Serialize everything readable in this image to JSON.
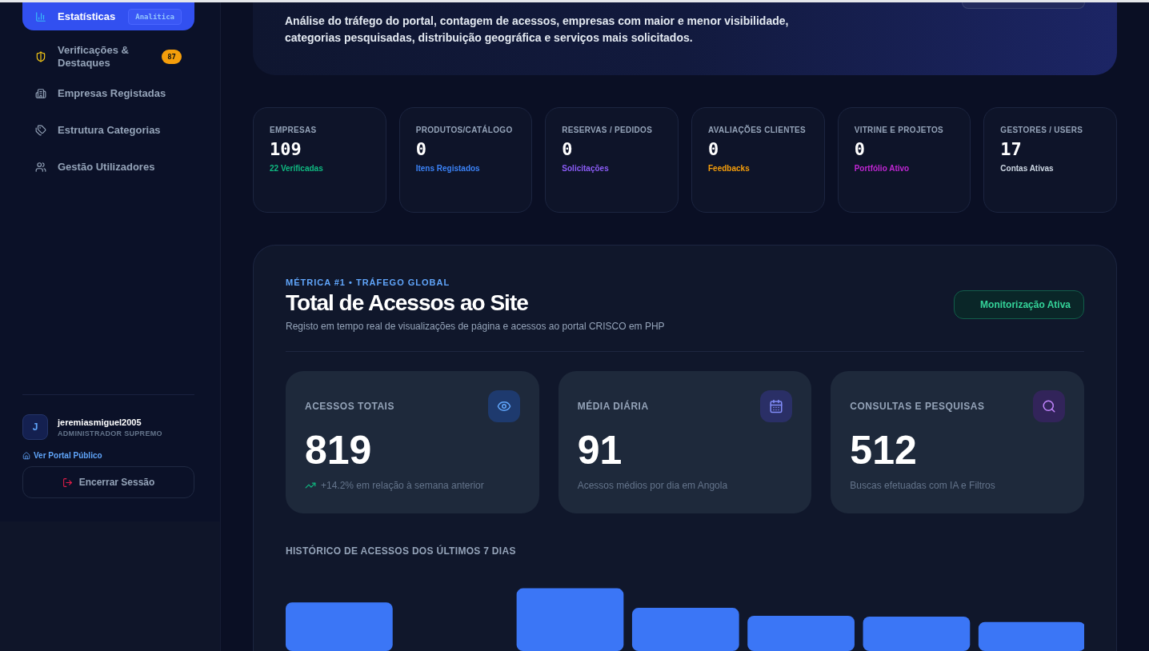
{
  "sidebar": {
    "items": [
      {
        "label": "Estatísticas",
        "selected": true,
        "tag": "Analítica"
      },
      {
        "label": "Verificações & Destaques",
        "selected": false,
        "badge": "87"
      },
      {
        "label": "Empresas Registadas",
        "selected": false
      },
      {
        "label": "Estrutura Categorias",
        "selected": false
      },
      {
        "label": "Gestão Utilizadores",
        "selected": false
      }
    ],
    "user": {
      "initial": "J",
      "name": "jeremiasmiguel2005",
      "role": "ADMINISTRADOR SUPREMO"
    },
    "portal_link": "Ver Portal Público",
    "logout": "Encerrar Sessão"
  },
  "hero": {
    "description": "Análise do tráfego do portal, contagem de acessos, empresas com maior e menor visibilidade, categorias pesquisadas, distribuição geográfica e serviços mais solicitados."
  },
  "stats": [
    {
      "label": "EMPRESAS",
      "value": "109",
      "note": "22 Verificadas",
      "color": "#10b981"
    },
    {
      "label": "PRODUTOS/CATÁLOGO",
      "value": "0",
      "note": "Itens Registados",
      "color": "#3b82f6"
    },
    {
      "label": "RESERVAS / PEDIDOS",
      "value": "0",
      "note": "Solicitações",
      "color": "#8b5cf6"
    },
    {
      "label": "AVALIAÇÕES CLIENTES",
      "value": "0",
      "note": "Feedbacks",
      "color": "#f59e0b"
    },
    {
      "label": "VITRINE E PROJETOS",
      "value": "0",
      "note": "Portfólio Ativo",
      "color": "#c026d3"
    },
    {
      "label": "GESTORES / USERS",
      "value": "17",
      "note": "Contas Ativas",
      "color": "#cbd5e1"
    }
  ],
  "panel": {
    "eyebrow": "MÉTRICA #1 • TRÁFEGO GLOBAL",
    "title": "Total de Acessos ao Site",
    "subtitle": "Registo em tempo real de visualizações de página e acessos ao portal CRISCO em PHP",
    "status": "Monitorização Ativa",
    "metrics": [
      {
        "label": "ACESSOS TOTAIS",
        "value": "819",
        "note": "+14.2% em relação à semana anterior",
        "trend": true
      },
      {
        "label": "MÉDIA DIÁRIA",
        "value": "91",
        "note": "Acessos médios por dia em Angola",
        "trend": false
      },
      {
        "label": "CONSULTAS E PESQUISAS",
        "value": "512",
        "note": "Buscas efetuadas com IA e Filtros",
        "trend": false
      }
    ],
    "history_title": "HISTÓRICO DE ACESSOS DOS ÚLTIMOS 7 DIAS"
  }
}
